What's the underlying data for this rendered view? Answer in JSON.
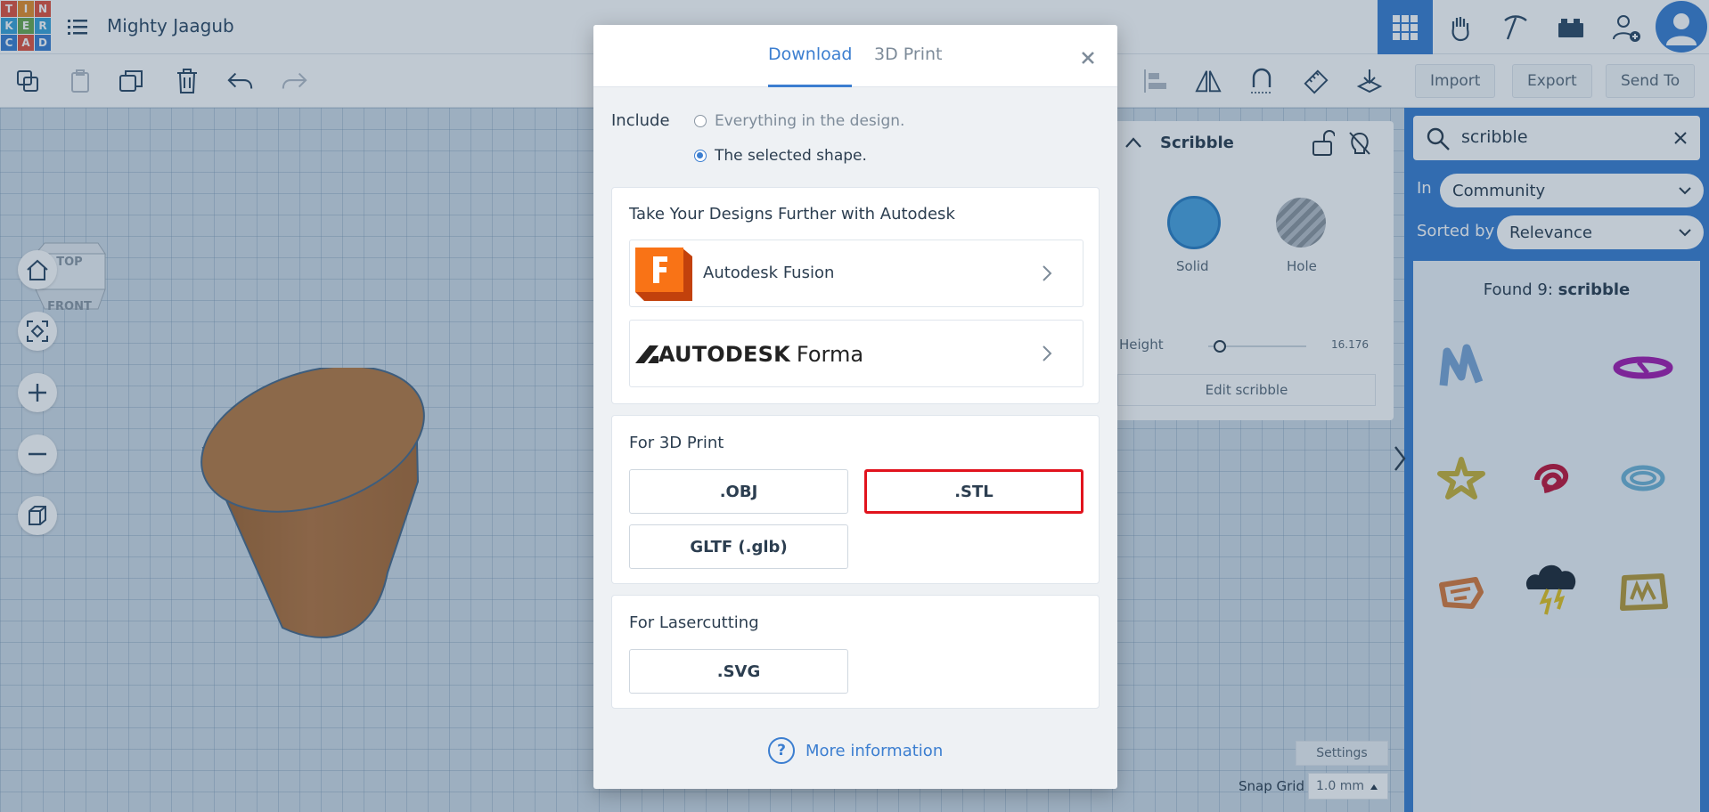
{
  "logo": {
    "letters": [
      "T",
      "I",
      "N",
      "K",
      "E",
      "R",
      "C",
      "A",
      "D"
    ],
    "colors": [
      "#e1523d",
      "#e58e2a",
      "#e1523d",
      "#3aa3d8",
      "#6aa84f",
      "#3aa3d8",
      "#3b7ed0",
      "#e1523d",
      "#3b7ed0"
    ]
  },
  "design": {
    "title": "Mighty Jaagub"
  },
  "toolbar": {
    "import_label": "Import",
    "export_label": "Export",
    "send_to_label": "Send To"
  },
  "viewcube": {
    "top_label": "TOP",
    "front_label": "FRONT"
  },
  "inspector": {
    "title": "Scribble",
    "solid_label": "Solid",
    "hole_label": "Hole",
    "height_label": "Height",
    "height_value": "16.176",
    "edit_label": "Edit scribble"
  },
  "workspace": {
    "settings_label": "Settings",
    "snap_grid_label": "Snap Grid",
    "snap_grid_value": "1.0 mm"
  },
  "library": {
    "search_value": "scribble",
    "in_label": "In",
    "in_value": "Community",
    "sorted_label": "Sorted by",
    "sorted_value": "Relevance",
    "found_prefix": "Found 9: ",
    "found_term": "scribble"
  },
  "modal": {
    "tabs": {
      "download": "Download",
      "print": "3D Print"
    },
    "include_label": "Include",
    "option_everything": "Everything in the design.",
    "option_selected": "The selected shape.",
    "autodesk_title": "Take Your Designs Further with Autodesk",
    "fusion_name": "Autodesk Fusion",
    "forma_brand": "AUTODESK",
    "forma_product": "Forma",
    "print_title": "For 3D Print",
    "btn_obj": ".OBJ",
    "btn_stl": ".STL",
    "btn_gltf": "GLTF (.glb)",
    "laser_title": "For Lasercutting",
    "btn_svg": ".SVG",
    "more_info": "More information"
  },
  "colors": {
    "accent": "#3b7ed0",
    "highlight": "#e1131d",
    "shape": "#b8763e"
  }
}
